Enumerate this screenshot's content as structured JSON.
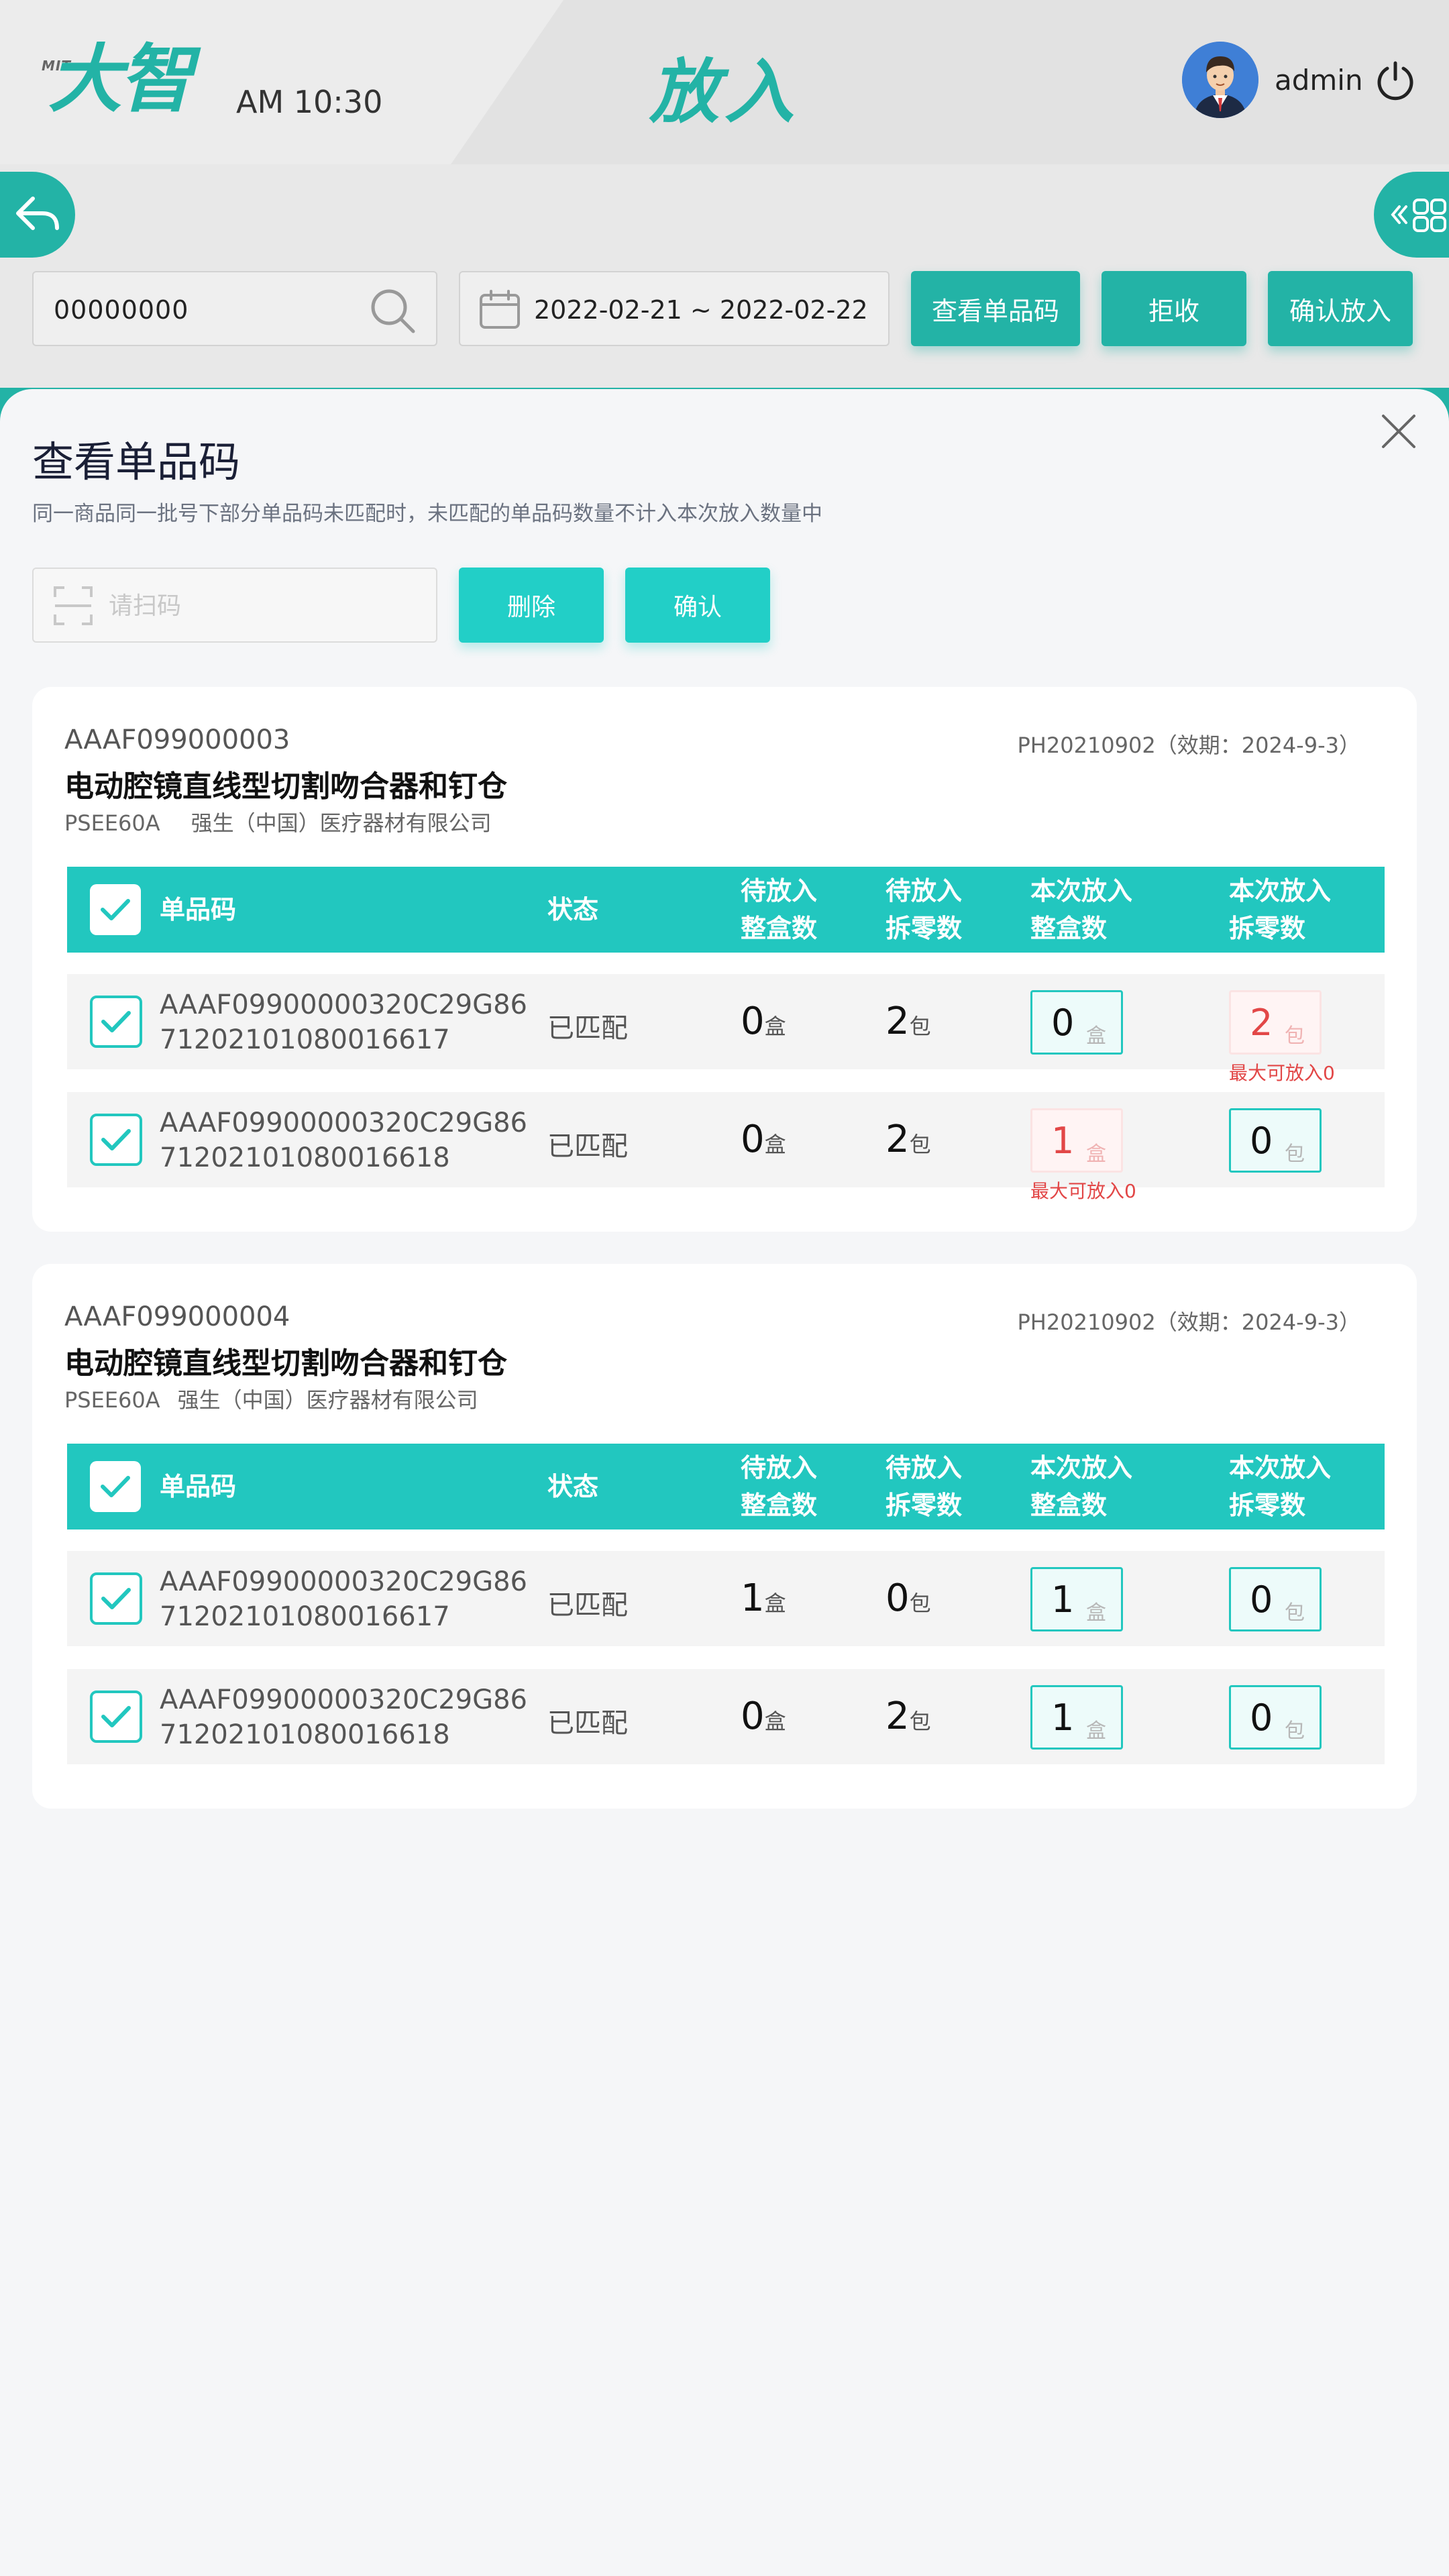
{
  "header": {
    "logo_small": "MIT",
    "logo_text": "大智",
    "time": "AM 10:30",
    "title": "放入",
    "username": "admin"
  },
  "toolbar": {
    "search_value": "00000000",
    "date_range": "2022-02-21 ~ 2022-02-22",
    "view_codes_label": "查看单品码",
    "reject_label": "拒收",
    "confirm_put_label": "确认放入"
  },
  "drawer": {
    "title": "查看单品码",
    "description": "同一商品同一批号下部分单品码未匹配时，未匹配的单品码数量不计入本次放入数量中",
    "scan_placeholder": "请扫码",
    "delete_label": "删除",
    "confirm_label": "确认"
  },
  "table_headers": {
    "code": "单品码",
    "status": "状态",
    "pending_whole_1": "待放入",
    "pending_whole_2": "整盒数",
    "pending_split_1": "待放入",
    "pending_split_2": "拆零数",
    "this_whole_1": "本次放入",
    "this_whole_2": "整盒数",
    "this_split_1": "本次放入",
    "this_split_2": "拆零数"
  },
  "units": {
    "box": "盒",
    "pack": "包"
  },
  "cards": [
    {
      "code": "AAAF099000003",
      "batch": "PH20210902（效期：2024-9-3）",
      "name": "电动腔镜直线型切割吻合器和钉仓",
      "spec": "PSEE60A",
      "company": "强生（中国）医疗器材有限公司",
      "rows": [
        {
          "code_line1": "AAAF09900000320C29G86",
          "code_line2": "71202101080016617",
          "status": "已匹配",
          "pending_whole": "0",
          "pending_split": "2",
          "this_whole": "0",
          "this_split": "2",
          "error": "最大可放入0"
        },
        {
          "code_line1": "AAAF09900000320C29G86",
          "code_line2": "71202101080016618",
          "status": "已匹配",
          "pending_whole": "0",
          "pending_split": "2",
          "this_whole": "1",
          "this_split": "0",
          "error": "最大可放入0"
        }
      ]
    },
    {
      "code": "AAAF099000004",
      "batch": "PH20210902（效期：2024-9-3）",
      "name": "电动腔镜直线型切割吻合器和钉仓",
      "spec": "PSEE60A",
      "company": "强生（中国）医疗器材有限公司",
      "rows": [
        {
          "code_line1": "AAAF09900000320C29G86",
          "code_line2": "71202101080016617",
          "status": "已匹配",
          "pending_whole": "1",
          "pending_split": "0",
          "this_whole": "1",
          "this_split": "0"
        },
        {
          "code_line1": "AAAF09900000320C29G86",
          "code_line2": "71202101080016618",
          "status": "已匹配",
          "pending_whole": "0",
          "pending_split": "2",
          "this_whole": "1",
          "this_split": "0"
        }
      ]
    }
  ],
  "colors": {
    "brand": "#23b3a6",
    "table_header": "#22c7bf",
    "error": "#e24747"
  },
  "icons": [
    "back-arrow-icon",
    "grid-menu-icon",
    "search-icon",
    "calendar-icon",
    "power-icon",
    "close-icon",
    "scan-icon",
    "checkbox-icon"
  ]
}
